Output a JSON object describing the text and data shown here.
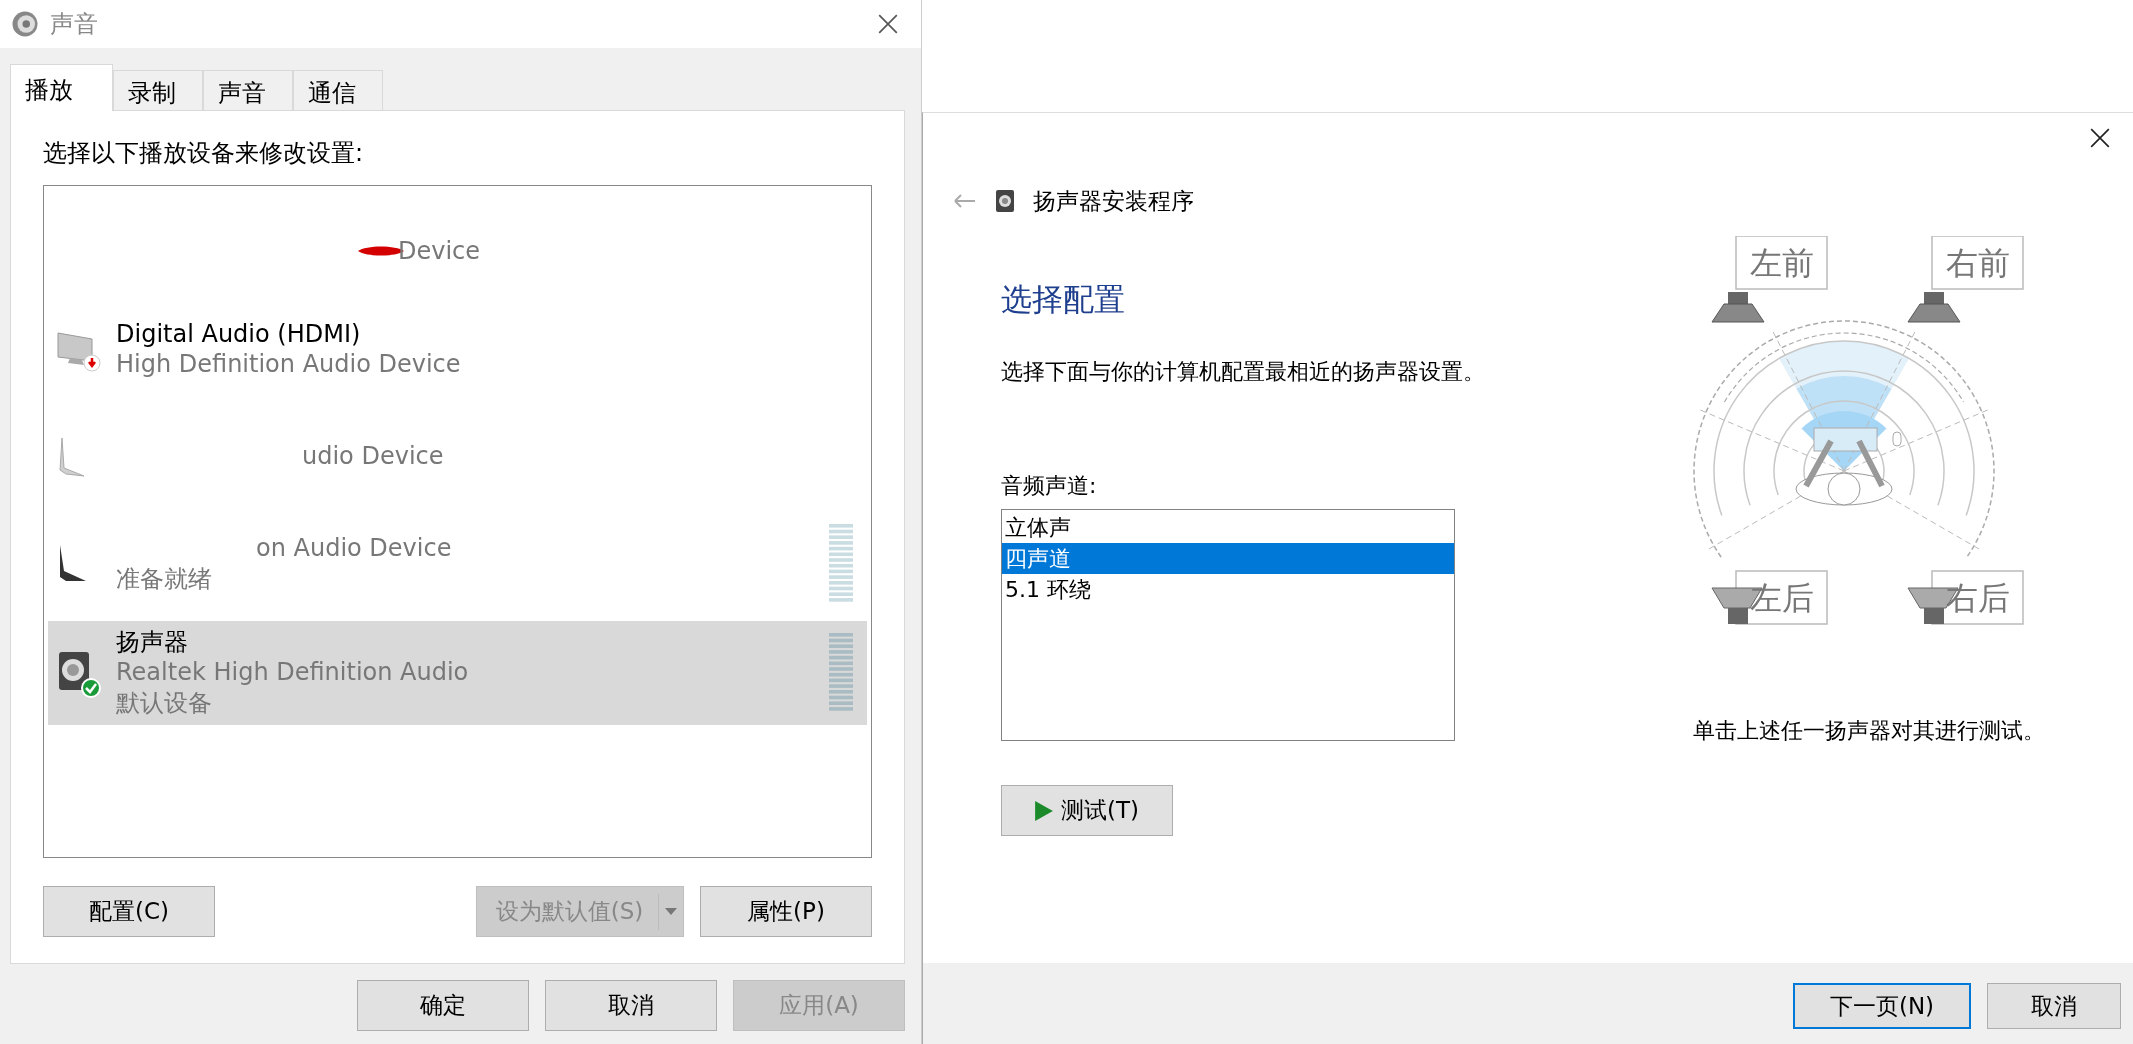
{
  "sound_window": {
    "title": "声音",
    "tabs": [
      {
        "label": "播放",
        "selected": true
      },
      {
        "label": "录制",
        "selected": false
      },
      {
        "label": "声音",
        "selected": false
      },
      {
        "label": "通信",
        "selected": false
      }
    ],
    "instruction": "选择以下播放设备来修改设置:",
    "devices": [
      {
        "kind": "blank",
        "name": "Device",
        "redacted": true,
        "selected": false,
        "meter": false
      },
      {
        "kind": "monitor-unplugged",
        "name": "Digital Audio (HDMI)",
        "description": "High Definition Audio Device",
        "selected": false,
        "meter": false
      },
      {
        "kind": "stand-light",
        "description": "udio Device",
        "selected": false,
        "meter": false
      },
      {
        "kind": "stand-dark",
        "description": "on Audio Device",
        "status": "准备就绪",
        "selected": false,
        "meter": true
      },
      {
        "kind": "speaker-default",
        "name": "扬声器",
        "description": "Realtek High Definition Audio",
        "status": "默认设备",
        "selected": true,
        "meter": true
      }
    ],
    "buttons": [
      {
        "label": "配置(C)",
        "disabled": false
      },
      {
        "label": "设为默认值(S)",
        "disabled": true,
        "dropdown": true
      },
      {
        "label": "属性(P)",
        "disabled": false
      }
    ],
    "footer_buttons": [
      {
        "label": "确定",
        "disabled": false
      },
      {
        "label": "取消",
        "disabled": false
      },
      {
        "label": "应用(A)",
        "disabled": true
      }
    ]
  },
  "setup_window": {
    "title": "扬声器安装程序",
    "heading": "选择配置",
    "description": "选择下面与你的计算机配置最相近的扬声器设置。",
    "channels_label": "音频声道:",
    "channels": [
      {
        "label": "立体声",
        "selected": false
      },
      {
        "label": "四声道",
        "selected": true
      },
      {
        "label": "5.1 环绕",
        "selected": false
      }
    ],
    "test_button": "测试(T)",
    "speakers": [
      {
        "label": "左前"
      },
      {
        "label": "右前"
      },
      {
        "label": "左后"
      },
      {
        "label": "右后"
      }
    ],
    "hint": "单击上述任一扬声器对其进行测试。",
    "footer_buttons": [
      {
        "label": "下一页(N)",
        "default": true
      },
      {
        "label": "取消",
        "default": false
      }
    ]
  }
}
